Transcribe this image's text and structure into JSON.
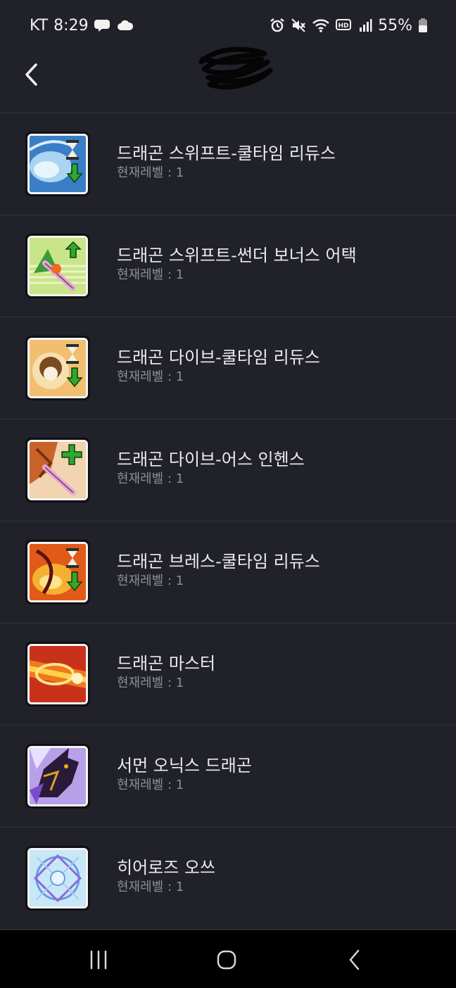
{
  "status_bar": {
    "carrier": "KT",
    "time": "8:29",
    "battery_percent": "55%",
    "icons": [
      "chat-bubble-icon",
      "cloud-icon",
      "alarm-icon",
      "mute-icon",
      "wifi-icon",
      "hd-icon",
      "signal-icon",
      "battery-icon"
    ]
  },
  "header": {
    "back_icon": "chevron-left-icon"
  },
  "skills": [
    {
      "name": "드래곤 스위프트-쿨타임 리듀스",
      "level": "현재레벨 : 1",
      "icon": "dragon-swift-cooldown-icon"
    },
    {
      "name": "드래곤 스위프트-썬더 보너스 어택",
      "level": "현재레벨 : 1",
      "icon": "dragon-swift-thunder-icon"
    },
    {
      "name": "드래곤 다이브-쿨타임 리듀스",
      "level": "현재레벨 : 1",
      "icon": "dragon-dive-cooldown-icon"
    },
    {
      "name": "드래곤 다이브-어스 인헨스",
      "level": "현재레벨 : 1",
      "icon": "dragon-dive-earth-icon"
    },
    {
      "name": "드래곤 브레스-쿨타임 리듀스",
      "level": "현재레벨 : 1",
      "icon": "dragon-breath-cooldown-icon"
    },
    {
      "name": "드래곤 마스터",
      "level": "현재레벨 : 1",
      "icon": "dragon-master-icon"
    },
    {
      "name": "서먼 오닉스 드래곤",
      "level": "현재레벨 : 1",
      "icon": "onyx-dragon-icon"
    },
    {
      "name": "히어로즈 오쓰",
      "level": "현재레벨 : 1",
      "icon": "heroes-oath-icon"
    }
  ],
  "nav_bar": {
    "items": [
      "recent-apps-icon",
      "home-icon",
      "back-icon"
    ]
  }
}
